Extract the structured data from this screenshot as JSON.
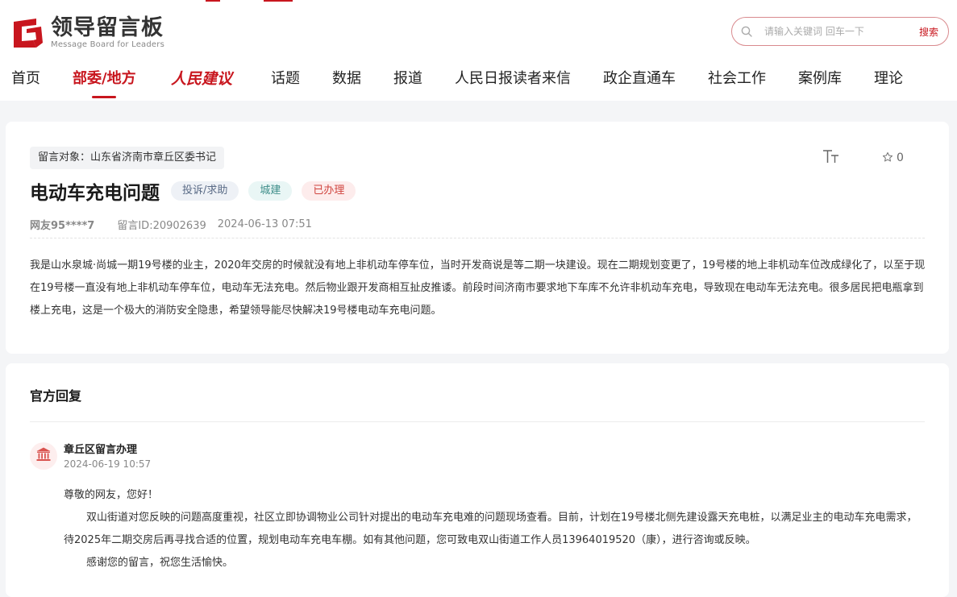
{
  "site": {
    "logo_cn": "领导留言板",
    "logo_en": "Message Board for Leaders",
    "brand_color": "#c8161e"
  },
  "search": {
    "placeholder": "请输入关键词 回车一下",
    "button_label": "搜索",
    "icon": "search-icon"
  },
  "nav": {
    "items": [
      {
        "label": "首页"
      },
      {
        "label": "部委/地方",
        "active": true
      },
      {
        "label": "人民建议"
      },
      {
        "label": "话题"
      },
      {
        "label": "数据"
      },
      {
        "label": "报道"
      },
      {
        "label": "人民日报读者来信"
      },
      {
        "label": "政企直通车"
      },
      {
        "label": "社会工作"
      },
      {
        "label": "案例库"
      },
      {
        "label": "理论"
      }
    ]
  },
  "message": {
    "target": "留言对象：山东省济南市章丘区委书记",
    "title": "电动车充电问题",
    "tags": {
      "type": "投诉/求助",
      "field": "城建",
      "status": "已办理"
    },
    "user": "网友95****7",
    "id": "留言ID:20902639",
    "time": "2024-06-13 07:51",
    "favorites": "0",
    "body": "我是山水泉城·尚城一期19号楼的业主，2020年交房的时候就没有地上非机动车停车位，当时开发商说是等二期一块建设。现在二期规划变更了，19号楼的地上非机动车位改成绿化了，以至于现在19号楼一直没有地上非机动车停车位，电动车无法充电。然后物业跟开发商相互扯皮推诿。前段时间济南市要求地下车库不允许非机动车充电，导致现在电动车无法充电。很多居民把电瓶拿到楼上充电，这是一个极大的消防安全隐患，希望领导能尽快解决19号楼电动车充电问题。"
  },
  "reply": {
    "heading": "官方回复",
    "department": "章丘区留言办理",
    "time": "2024-06-19 10:57",
    "greeting": "尊敬的网友，您好！",
    "paragraph": "双山街道对您反映的问题高度重视，社区立即协调物业公司针对提出的电动车充电难的问题现场查看。目前，计划在19号楼北侧先建设露天充电桩，以满足业主的电动车充电需求，待2025年二期交房后再寻找合适的位置，规划电动车充电车棚。如有其他问题，您可致电双山街道工作人员13964019520（康），进行咨询或反映。",
    "closing": "感谢您的留言，祝您生活愉快。"
  }
}
